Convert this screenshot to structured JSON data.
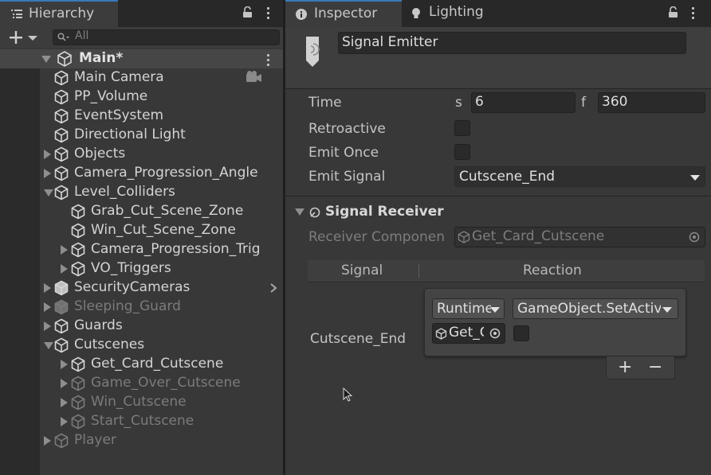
{
  "hierarchy": {
    "tab_label": "Hierarchy",
    "search_placeholder": "All",
    "scene_name": "Main*",
    "items": [
      {
        "label": "Main Camera",
        "indent": 0,
        "expander": "none",
        "dim": false
      },
      {
        "label": "PP_Volume",
        "indent": 0,
        "expander": "none",
        "dim": false
      },
      {
        "label": "EventSystem",
        "indent": 0,
        "expander": "none",
        "dim": false
      },
      {
        "label": "Directional Light",
        "indent": 0,
        "expander": "none",
        "dim": false
      },
      {
        "label": "Objects",
        "indent": 0,
        "expander": "collapsed",
        "dim": false
      },
      {
        "label": "Camera_Progression_Angle",
        "indent": 0,
        "expander": "collapsed",
        "dim": false
      },
      {
        "label": "Level_Colliders",
        "indent": 0,
        "expander": "expanded",
        "dim": false
      },
      {
        "label": "Grab_Cut_Scene_Zone",
        "indent": 1,
        "expander": "none",
        "dim": false
      },
      {
        "label": "Win_Cut_Scene_Zone",
        "indent": 1,
        "expander": "none",
        "dim": false
      },
      {
        "label": "Camera_Progression_Trig",
        "indent": 1,
        "expander": "collapsed",
        "dim": false
      },
      {
        "label": "VO_Triggers",
        "indent": 1,
        "expander": "collapsed",
        "dim": false
      },
      {
        "label": "SecurityCameras",
        "indent": 0,
        "expander": "collapsed",
        "dim": false
      },
      {
        "label": "Sleeping_Guard",
        "indent": 0,
        "expander": "collapsed",
        "dim": true
      },
      {
        "label": "Guards",
        "indent": 0,
        "expander": "collapsed",
        "dim": false
      },
      {
        "label": "Cutscenes",
        "indent": 0,
        "expander": "expanded",
        "dim": false
      },
      {
        "label": "Get_Card_Cutscene",
        "indent": 1,
        "expander": "collapsed",
        "dim": false
      },
      {
        "label": "Game_Over_Cutscene",
        "indent": 1,
        "expander": "collapsed",
        "dim": true
      },
      {
        "label": "Win_Cutscene",
        "indent": 1,
        "expander": "collapsed",
        "dim": true
      },
      {
        "label": "Start_Cutscene",
        "indent": 1,
        "expander": "collapsed",
        "dim": true
      },
      {
        "label": "Player",
        "indent": 0,
        "expander": "collapsed",
        "dim": true
      }
    ]
  },
  "inspector": {
    "tab_inspector": "Inspector",
    "tab_lighting": "Lighting",
    "object_name": "Signal Emitter",
    "time_label": "Time",
    "time_s_label": "s",
    "time_s_value": "6",
    "time_f_label": "f",
    "time_f_value": "360",
    "retroactive_label": "Retroactive",
    "emit_once_label": "Emit Once",
    "emit_signal_label": "Emit Signal",
    "emit_signal_value": "Cutscene_End",
    "component_title": "Signal Receiver",
    "receiver_component_label": "Receiver Componen",
    "receiver_component_value": "Get_Card_Cutscene",
    "table_signal_header": "Signal",
    "table_reaction_header": "Reaction",
    "row_signal": "Cutscene_End",
    "runtime_dropdown": "Runtime",
    "function_dropdown": "GameObject.SetActive",
    "target_object": "Get_Card_Cutscene",
    "plus_label": "+",
    "minus_label": "−"
  },
  "colors": {
    "tab_accent": "#3a79bb",
    "panel_bg": "#383838",
    "field_bg": "#2a2a2a"
  }
}
